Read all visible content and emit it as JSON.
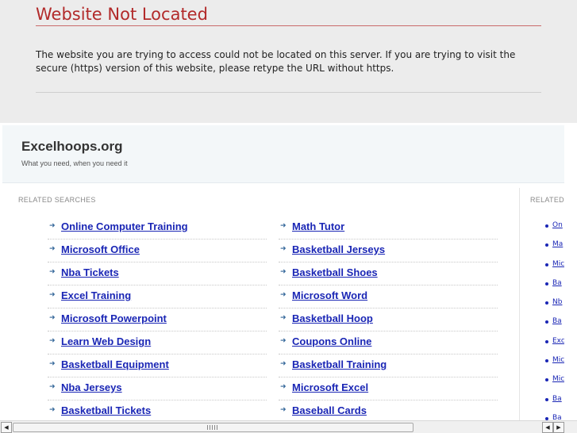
{
  "error": {
    "title": "Website Not Located",
    "message": "The website you are trying to access could not be located on this server. If you are trying to visit the secure (https) version of this website, please retype the URL without https."
  },
  "site": {
    "title": "Excelhoops.org",
    "tagline": "What you need, when you need it"
  },
  "related": {
    "label": "RELATED SEARCHES",
    "right_label": "RELATED",
    "left_column": [
      "Online Computer Training",
      "Microsoft Office",
      "Nba Tickets",
      "Excel Training",
      "Microsoft Powerpoint",
      "Learn Web Design",
      "Basketball Equipment",
      "Nba Jerseys",
      "Basketball Tickets"
    ],
    "right_column": [
      "Math Tutor",
      "Basketball Jerseys",
      "Basketball Shoes",
      "Microsoft Word",
      "Basketball Hoop",
      "Coupons Online",
      "Basketball Training",
      "Microsoft Excel",
      "Baseball Cards"
    ],
    "sidebar": [
      "On",
      "Ma",
      "Mic",
      "Ba",
      "Nb",
      "Ba",
      "Exc",
      "Mic",
      "Mic",
      "Ba",
      "Ba"
    ]
  },
  "icons": {
    "arrow": "right-arrow-icon",
    "scroll_up": "up-arrow-icon",
    "scroll_down": "down-arrow-icon",
    "scroll_left": "left-arrow-icon",
    "scroll_right": "right-arrow-icon"
  },
  "colors": {
    "error_title": "#b22a2a",
    "link": "#1a26b5",
    "header_bg": "#f3f7f9",
    "page_bg": "#ececec"
  }
}
